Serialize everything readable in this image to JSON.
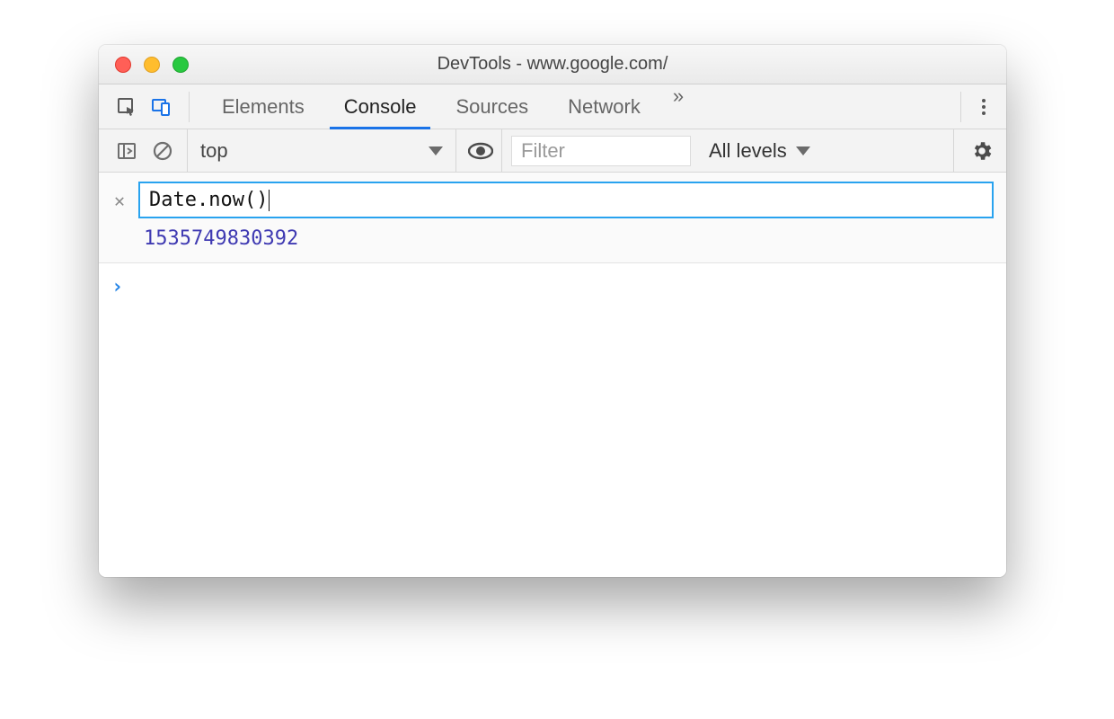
{
  "window": {
    "title": "DevTools - www.google.com/"
  },
  "tabs": {
    "items": [
      "Elements",
      "Console",
      "Sources",
      "Network"
    ],
    "active": "Console",
    "overflow_glyph": "»"
  },
  "subbar": {
    "context": "top",
    "filter_placeholder": "Filter",
    "levels_label": "All levels"
  },
  "console": {
    "eager_expression": "Date.now()",
    "eager_result": "1535749830392",
    "prompt_value": ""
  }
}
